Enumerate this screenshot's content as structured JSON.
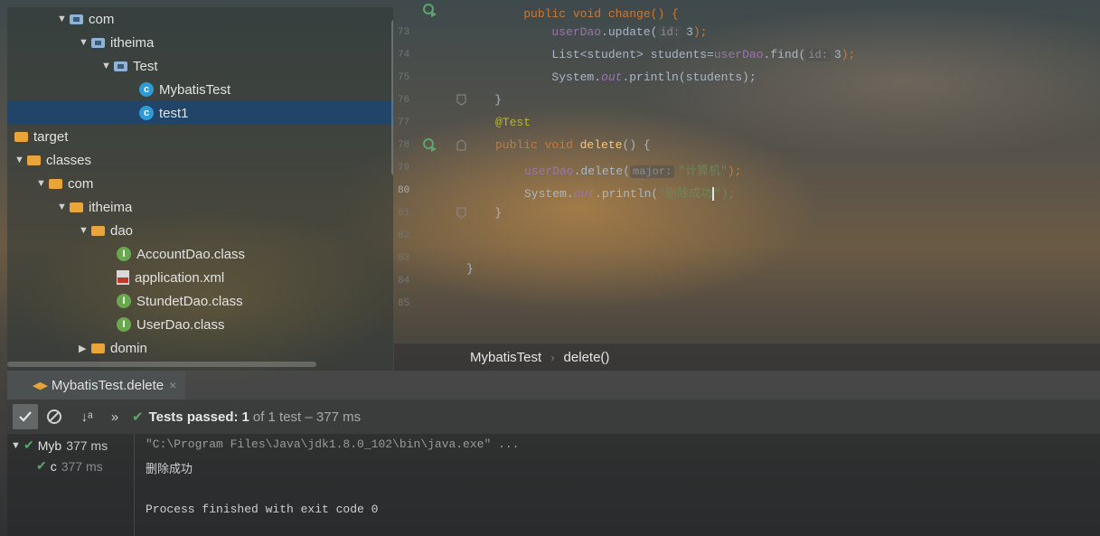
{
  "project_tree": {
    "items": [
      {
        "label": "com"
      },
      {
        "label": "itheima"
      },
      {
        "label": "Test"
      },
      {
        "label": "MybatisTest"
      },
      {
        "label": "test1"
      },
      {
        "label": "target"
      },
      {
        "label": "classes"
      },
      {
        "label": "com"
      },
      {
        "label": "itheima"
      },
      {
        "label": "dao"
      },
      {
        "label": "AccountDao.class"
      },
      {
        "label": "application.xml"
      },
      {
        "label": "StundetDao.class"
      },
      {
        "label": "UserDao.class"
      },
      {
        "label": "domin"
      }
    ]
  },
  "editor": {
    "lines": [
      {
        "num": "73",
        "indent": "        ",
        "obj": "userDao",
        "call": "update(",
        "hint": "id:",
        "arg": "3",
        "close": ");"
      },
      {
        "num": "74",
        "indent": "        ",
        "type": "List<student> students=",
        "obj": "userDao",
        "call": "find(",
        "hint": "id:",
        "arg": "3",
        "close": ");"
      },
      {
        "num": "75",
        "indent": "        ",
        "sys": "System.",
        "out": "out",
        "rest": ".println(students);"
      },
      {
        "num": "76",
        "text": "    }"
      },
      {
        "num": "77",
        "annotation": "@Test"
      },
      {
        "num": "78",
        "kw": "public void ",
        "method": "delete",
        "rest": "() {"
      },
      {
        "num": "79",
        "obj": "userDao",
        "call": ".delete(",
        "hint": "major:",
        "arg": "\"计算机\"",
        "close": ");"
      },
      {
        "num": "80",
        "sys": "System.",
        "out": "out",
        "rest_a": ".println(",
        "arg": "\"删除成功",
        "rest_b": "\");"
      },
      {
        "num": "81",
        "text": "    }"
      },
      {
        "num": "82",
        "text": ""
      },
      {
        "num": "83",
        "text": ""
      },
      {
        "num": "84",
        "text": "}"
      },
      {
        "num": "85",
        "text": ""
      }
    ],
    "top_partial": "public void change() {"
  },
  "breadcrumb": {
    "class_name": "MybatisTest",
    "method": "delete()"
  },
  "run_panel": {
    "tab_label": "MybatisTest.delete",
    "status_prefix": "Tests passed:",
    "status_count": "1",
    "status_rest": "of 1 test – 377 ms",
    "test_tree": [
      {
        "label": "Myb",
        "time": "377 ms"
      },
      {
        "label": "c",
        "time": "377 ms"
      }
    ],
    "console": {
      "command": "\"C:\\Program Files\\Java\\jdk1.8.0_102\\bin\\java.exe\" ...",
      "output": "删除成功",
      "exit": "Process finished with exit code 0"
    }
  },
  "colors": {
    "selection": "#1c466e",
    "pass_green": "#59a869",
    "keyword": "#cc7832"
  }
}
